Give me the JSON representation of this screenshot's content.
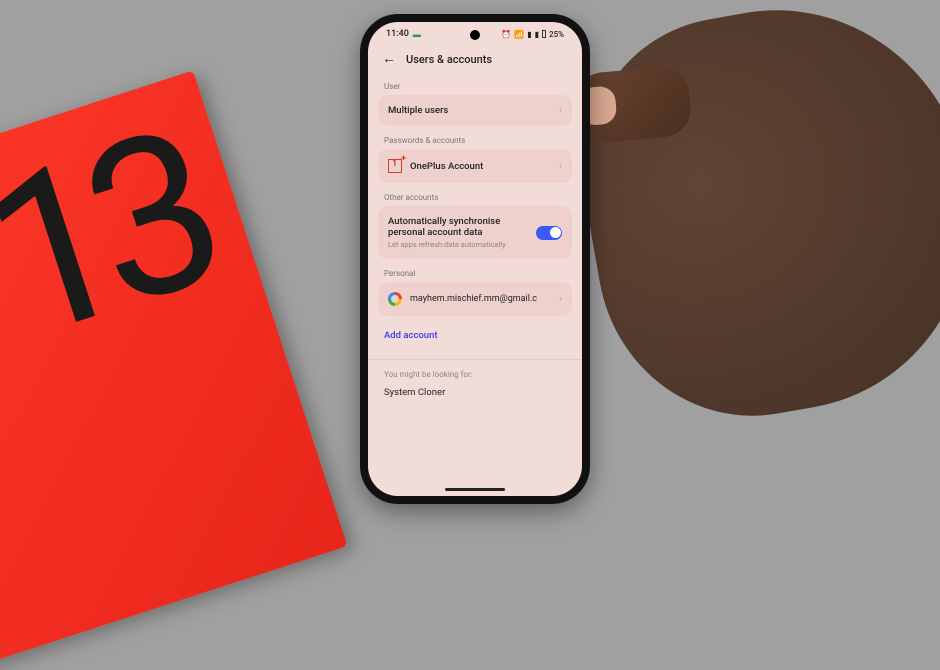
{
  "status_bar": {
    "time": "11:40",
    "battery": "25%"
  },
  "header": {
    "title": "Users & accounts"
  },
  "sections": {
    "user_label": "User",
    "multiple_users": "Multiple users",
    "passwords_label": "Passwords & accounts",
    "oneplus_account": "OnePlus Account",
    "other_label": "Other accounts",
    "sync_title": "Automatically synchronise personal account data",
    "sync_sub": "Let apps refresh data automatically",
    "personal_label": "Personal",
    "email": "mayhem.mischief.mm@gmail.c",
    "add_account": "Add account",
    "suggest_label": "You might be looking for:",
    "system_cloner": "System Cloner"
  },
  "box_text": "13"
}
